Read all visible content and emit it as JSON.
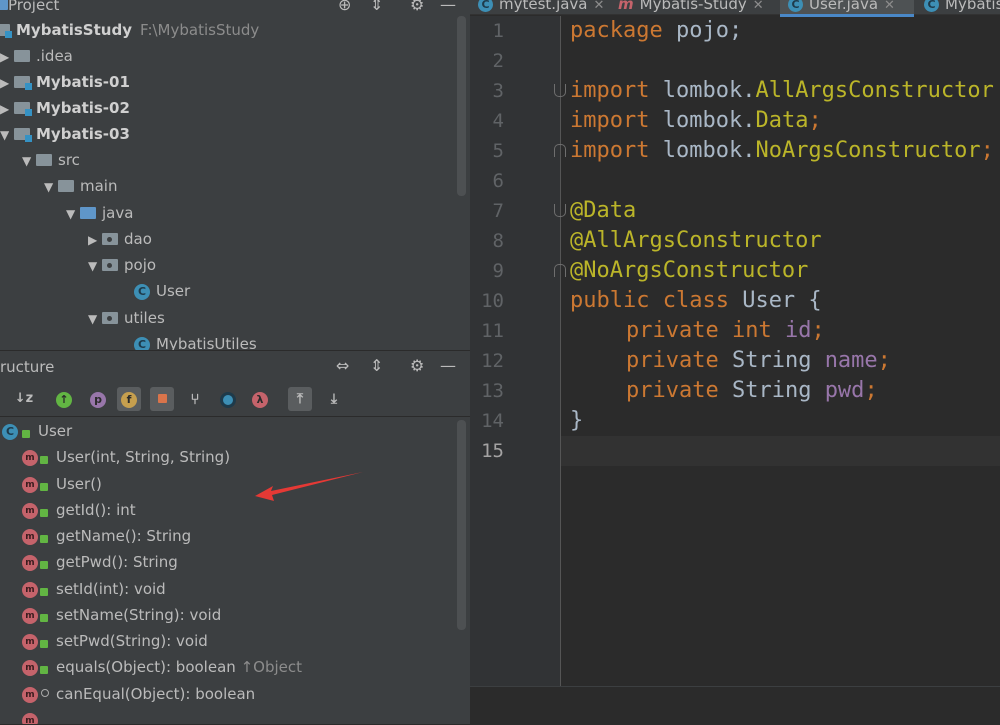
{
  "project": {
    "title": "Project",
    "tree": [
      {
        "label": "MybatisStudy",
        "path": "F:\\MybatisStudy",
        "level": 0,
        "arrow": "▼",
        "bold": true
      },
      {
        "label": ".idea",
        "level": 1,
        "arrow": "▶"
      },
      {
        "label": "Mybatis-01",
        "level": 1,
        "arrow": "▶",
        "bold": true
      },
      {
        "label": "Mybatis-02",
        "level": 1,
        "arrow": "▶",
        "bold": true
      },
      {
        "label": "Mybatis-03",
        "level": 1,
        "arrow": "▼",
        "bold": true
      },
      {
        "label": "src",
        "level": 2,
        "arrow": "▼"
      },
      {
        "label": "main",
        "level": 3,
        "arrow": "▼"
      },
      {
        "label": "java",
        "level": 4,
        "arrow": "▼"
      },
      {
        "label": "dao",
        "level": 5,
        "arrow": "▶"
      },
      {
        "label": "pojo",
        "level": 5,
        "arrow": "▼"
      },
      {
        "label": "User",
        "level": 6,
        "arrow": ""
      },
      {
        "label": "utiles",
        "level": 5,
        "arrow": "▼"
      },
      {
        "label": "MybatisUtiles",
        "level": 6,
        "arrow": ""
      }
    ]
  },
  "structure": {
    "title": "ructure",
    "root": {
      "label": "User",
      "icon": "C"
    },
    "items": [
      {
        "label": "User(int, String, String)",
        "inherit": ""
      },
      {
        "label": "User()",
        "inherit": ""
      },
      {
        "label": "getId(): int",
        "inherit": ""
      },
      {
        "label": "getName(): String",
        "inherit": ""
      },
      {
        "label": "getPwd(): String",
        "inherit": ""
      },
      {
        "label": "setId(int): void",
        "inherit": ""
      },
      {
        "label": "setName(String): void",
        "inherit": ""
      },
      {
        "label": "setPwd(String): void",
        "inherit": ""
      },
      {
        "label": "equals(Object): boolean ",
        "inherit": "↑Object"
      },
      {
        "label": "canEqual(Object): boolean",
        "inherit": ""
      }
    ],
    "method_icon": "m",
    "toolbar": {
      "f": "f",
      "p": "p",
      "lambda": "λ"
    }
  },
  "editor": {
    "tabs": [
      {
        "label": "mytest.java"
      },
      {
        "label": "Mybatis-Study"
      },
      {
        "label": "User.java",
        "active": true
      },
      {
        "label": "Mybatis"
      }
    ],
    "line_numbers": [
      "1",
      "2",
      "3",
      "4",
      "5",
      "6",
      "7",
      "8",
      "9",
      "10",
      "11",
      "12",
      "13",
      "14",
      "15"
    ],
    "code": {
      "l1_kw": "package",
      "l1_rest": " pojo;",
      "l3_kw": "import",
      "l3_rest": " lombok.",
      "l3_ann": "AllArgsConstructor",
      "l4_kw": "import",
      "l4_rest": " lombok.",
      "l4_ann": "Data",
      "l4_end": ";",
      "l5_kw": "import",
      "l5_rest": " lombok.",
      "l5_ann": "NoArgsConstructor",
      "l5_end": ";",
      "l7": "@Data",
      "l8": "@AllArgsConstructor",
      "l9": "@NoArgsConstructor",
      "l10_kw": "public class",
      "l10_rest": " User {",
      "l11_kw": "private int",
      "l11_fld": "id",
      "l11_end": ";",
      "l12_kw": "private",
      "l12_type": " String ",
      "l12_fld": "name",
      "l12_end": ";",
      "l13_kw": "private",
      "l13_type": " String ",
      "l13_fld": "pwd",
      "l13_end": ";",
      "l14": "}"
    }
  },
  "colors": {
    "keyword": "#cc7832",
    "annotation": "#bbb529",
    "field": "#9876aa",
    "text": "#a9b7c6",
    "arrow": "#e53935"
  }
}
